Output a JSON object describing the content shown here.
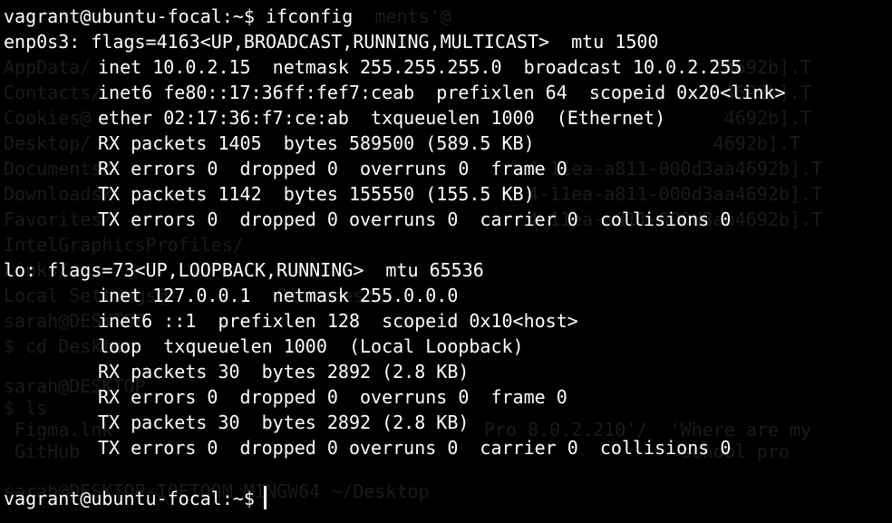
{
  "colors": {
    "background": "#000000",
    "text": "#ffffff",
    "ghost_text": "#1a1a1a"
  },
  "ghost": {
    "l0": "                                  ments'@",
    "l1": "AppData/                                                          4692b].T",
    "l2": "Contacts/                                                         4692b].T",
    "l3": "Cookies@                                                          4692b].T",
    "l4": "Desktop/                                                         4692b].T",
    "l5": "Documents/                                      4-11ea-a811-000d3aa4692b].T",
    "l6": "Downloads/                                      4-11ea-a811-000d3aa4692b].T",
    "l7": "Favorites/                                      4-11ea-a811-000d3aa4692b].T",
    "l8": "IntelGraphicsProfiles/",
    "l9": "Links/",
    "l10": "Local Settings@          Pictures/",
    "l12": "",
    "l13": "sarah@DESKTOP",
    "l14": "$ cd Desktop",
    "l16": "sarah@DESKTOP",
    "l17": "$ ls",
    "l18": " Figma.lnk                                  Pro 8.0.2.210'/  'Where are my",
    "l19": " GitHub                                                       school pro",
    "l21": "sarah@DESKTOP-IOETQOM MINGW64 ~/Desktop"
  },
  "terminal": {
    "prompt": "vagrant@ubuntu-focal:~$ ",
    "command": "ifconfig",
    "lines": {
      "l1": "enp0s3: flags=4163<UP,BROADCAST,RUNNING,MULTICAST>  mtu 1500",
      "l2": "inet 10.0.2.15  netmask 255.255.255.0  broadcast 10.0.2.255",
      "l3": "inet6 fe80::17:36ff:fef7:ceab  prefixlen 64  scopeid 0x20<link>",
      "l4": "ether 02:17:36:f7:ce:ab  txqueuelen 1000  (Ethernet)",
      "l5": "RX packets 1405  bytes 589500 (589.5 KB)",
      "l6": "RX errors 0  dropped 0  overruns 0  frame 0",
      "l7": "TX packets 1142  bytes 155550 (155.5 KB)",
      "l8": "TX errors 0  dropped 0 overruns 0  carrier 0  collisions 0",
      "l10": "lo: flags=73<UP,LOOPBACK,RUNNING>  mtu 65536",
      "l11": "inet 127.0.0.1  netmask 255.0.0.0",
      "l12": "inet6 ::1  prefixlen 128  scopeid 0x10<host>",
      "l13": "loop  txqueuelen 1000  (Local Loopback)",
      "l14": "RX packets 30  bytes 2892 (2.8 KB)",
      "l15": "RX errors 0  dropped 0  overruns 0  frame 0",
      "l16": "TX packets 30  bytes 2892 (2.8 KB)",
      "l17": "TX errors 0  dropped 0 overruns 0  carrier 0  collisions 0"
    },
    "final_prompt": "vagrant@ubuntu-focal:~$"
  }
}
